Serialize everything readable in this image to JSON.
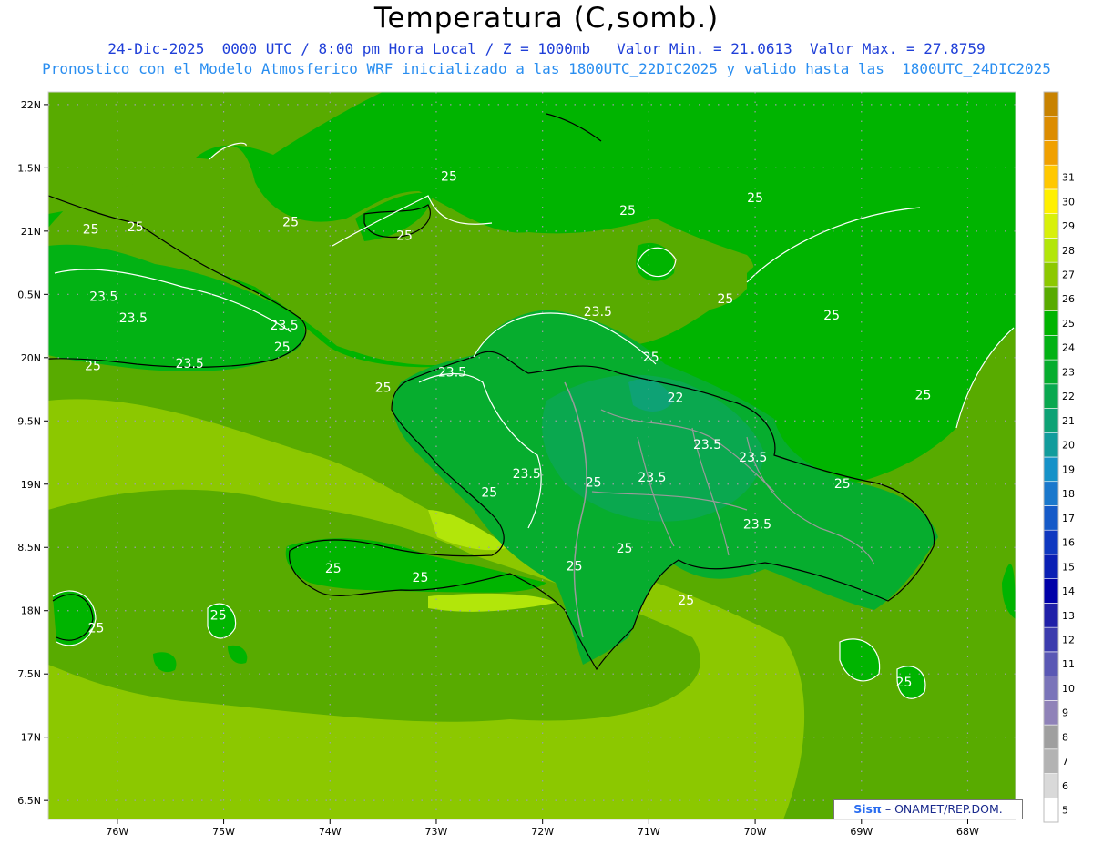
{
  "header": {
    "title": "Temperatura (C,somb.)",
    "line1": "24-Dic-2025  0000 UTC / 8:00 pm Hora Local / Z = 1000mb   Valor Min. = 21.0613  Valor Max. = 27.8759",
    "line2": "Pronostico con el Modelo Atmosferico WRF inicializado a las 1800UTC_22DIC2025 y valido hasta las  1800UTC_24DIC2025"
  },
  "map": {
    "lon_range": [
      -76.65,
      -67.55
    ],
    "lat_range": [
      16.35,
      22.1
    ],
    "lon_ticks": [
      {
        "value": -76,
        "label": "76W"
      },
      {
        "value": -75,
        "label": "75W"
      },
      {
        "value": -74,
        "label": "74W"
      },
      {
        "value": -73,
        "label": "73W"
      },
      {
        "value": -72,
        "label": "72W"
      },
      {
        "value": -71,
        "label": "71W"
      },
      {
        "value": -70,
        "label": "70W"
      },
      {
        "value": -69,
        "label": "69W"
      },
      {
        "value": -68,
        "label": "68W"
      }
    ],
    "lat_ticks": [
      {
        "value": 22,
        "label": "22N"
      },
      {
        "value": 21.5,
        "label": "1.5N"
      },
      {
        "value": 21,
        "label": "21N"
      },
      {
        "value": 20.5,
        "label": "0.5N"
      },
      {
        "value": 20,
        "label": "20N"
      },
      {
        "value": 19.5,
        "label": "9.5N"
      },
      {
        "value": 19,
        "label": "19N"
      },
      {
        "value": 18.5,
        "label": "8.5N"
      },
      {
        "value": 18,
        "label": "18N"
      },
      {
        "value": 17.5,
        "label": "7.5N"
      },
      {
        "value": 17,
        "label": "17N"
      },
      {
        "value": 16.5,
        "label": "6.5N"
      }
    ],
    "contour_labels": [
      {
        "text": "25",
        "lon": -76.25,
        "lat": 20.98
      },
      {
        "text": "25",
        "lon": -75.83,
        "lat": 21.0
      },
      {
        "text": "25",
        "lon": -74.37,
        "lat": 21.04
      },
      {
        "text": "25",
        "lon": -73.3,
        "lat": 20.93
      },
      {
        "text": "25",
        "lon": -72.88,
        "lat": 21.4
      },
      {
        "text": "25",
        "lon": -71.2,
        "lat": 21.13
      },
      {
        "text": "25",
        "lon": -70.0,
        "lat": 21.23
      },
      {
        "text": "25",
        "lon": -70.28,
        "lat": 20.43
      },
      {
        "text": "25",
        "lon": -69.28,
        "lat": 20.3
      },
      {
        "text": "25",
        "lon": -68.42,
        "lat": 19.67
      },
      {
        "text": "25",
        "lon": -76.23,
        "lat": 19.9
      },
      {
        "text": "25",
        "lon": -74.45,
        "lat": 20.05
      },
      {
        "text": "25",
        "lon": -73.5,
        "lat": 19.73
      },
      {
        "text": "25",
        "lon": -70.98,
        "lat": 19.97
      },
      {
        "text": "25",
        "lon": -72.5,
        "lat": 18.9
      },
      {
        "text": "25",
        "lon": -71.52,
        "lat": 18.98
      },
      {
        "text": "25",
        "lon": -71.23,
        "lat": 18.46
      },
      {
        "text": "25",
        "lon": -71.7,
        "lat": 18.32
      },
      {
        "text": "25",
        "lon": -73.97,
        "lat": 18.3
      },
      {
        "text": "25",
        "lon": -73.15,
        "lat": 18.23
      },
      {
        "text": "25",
        "lon": -69.18,
        "lat": 18.97
      },
      {
        "text": "25",
        "lon": -70.65,
        "lat": 18.05
      },
      {
        "text": "25",
        "lon": -75.05,
        "lat": 17.93
      },
      {
        "text": "25",
        "lon": -76.2,
        "lat": 17.83
      },
      {
        "text": "25",
        "lon": -68.6,
        "lat": 17.4
      },
      {
        "text": "22",
        "lon": -70.75,
        "lat": 19.65
      },
      {
        "text": "23.5",
        "lon": -76.13,
        "lat": 20.45
      },
      {
        "text": "23.5",
        "lon": -75.85,
        "lat": 20.28
      },
      {
        "text": "23.5",
        "lon": -74.43,
        "lat": 20.22
      },
      {
        "text": "23.5",
        "lon": -75.32,
        "lat": 19.92
      },
      {
        "text": "23.5",
        "lon": -71.48,
        "lat": 20.33
      },
      {
        "text": "23.5",
        "lon": -72.85,
        "lat": 19.85
      },
      {
        "text": "23.5",
        "lon": -72.15,
        "lat": 19.05
      },
      {
        "text": "23.5",
        "lon": -70.97,
        "lat": 19.02
      },
      {
        "text": "23.5",
        "lon": -70.45,
        "lat": 19.28
      },
      {
        "text": "23.5",
        "lon": -70.02,
        "lat": 19.18
      },
      {
        "text": "23.5",
        "lon": -69.98,
        "lat": 18.65
      }
    ]
  },
  "colorbar": {
    "colors": [
      "#ffffff",
      "#d9d9d9",
      "#b3b3b3",
      "#9f9f9f",
      "#8f82b8",
      "#7a74b9",
      "#5a58b4",
      "#3c3cae",
      "#2020a8",
      "#0000a8",
      "#0a1fb4",
      "#0f38c0",
      "#155ac8",
      "#1a78cc",
      "#1692c8",
      "#129c9c",
      "#0ea275",
      "#0aa84f",
      "#06ad2e",
      "#02b214",
      "#00b400",
      "#58ab00",
      "#8cc800",
      "#b2e60a",
      "#d8f00a",
      "#fff000",
      "#ffc800",
      "#f0a000",
      "#dc8c00",
      "#c88200"
    ],
    "labels": [
      "5",
      "6",
      "7",
      "8",
      "9",
      "10",
      "11",
      "12",
      "13",
      "14",
      "15",
      "16",
      "17",
      "18",
      "19",
      "20",
      "21",
      "22",
      "23",
      "24",
      "25",
      "26",
      "27",
      "28",
      "29",
      "30",
      "31"
    ]
  },
  "credit": {
    "logo": "Sisπ",
    "text": "– ONAMET/REP.DOM."
  }
}
